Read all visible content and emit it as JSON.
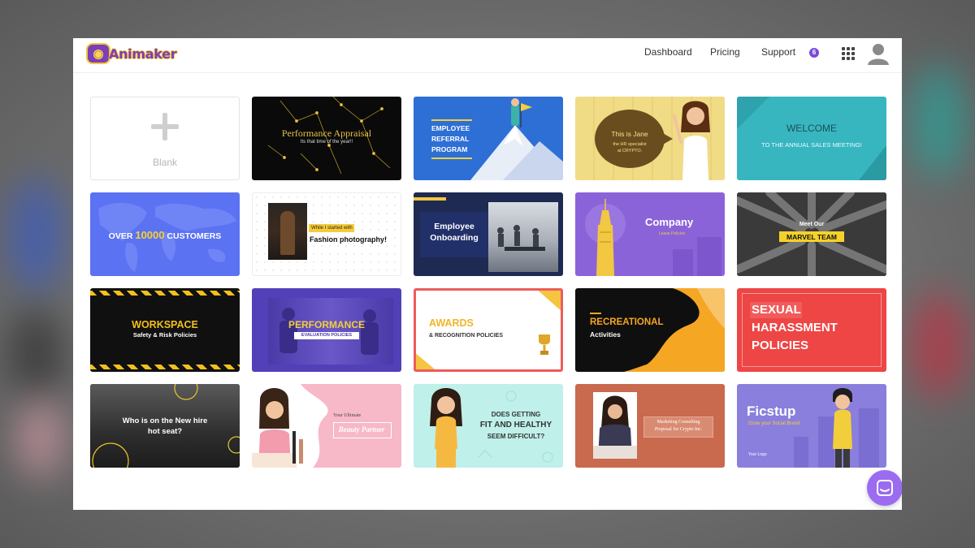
{
  "brand": {
    "name": "Animaker",
    "accent": "#7b3fb8",
    "logo_icon": "animaker-logo-icon"
  },
  "nav": {
    "dashboard": "Dashboard",
    "pricing": "Pricing",
    "support": "Support",
    "notification_count": "6"
  },
  "icons": {
    "apps": "apps-grid-icon",
    "avatar": "user-avatar-icon",
    "chat": "chat-support-icon"
  },
  "blank": {
    "label": "Blank"
  },
  "templates": {
    "performance_appraisal": {
      "title": "Performance Appraisal",
      "subtitle": "Its that time of the year!!"
    },
    "employee_referral": {
      "title_lines": [
        "EMPLOYEE",
        "REFERRAL",
        "PROGRAM"
      ]
    },
    "hr_specialist": {
      "line1": "This is Jane",
      "line2": "the HR specialist",
      "line3": "at CRYPTO."
    },
    "welcome": {
      "title": "WELCOME",
      "subtitle": "TO THE ANNUAL SALES MEETING!"
    },
    "customers": {
      "prefix": "OVER ",
      "number": "10000",
      "suffix": " CUSTOMERS"
    },
    "fashion": {
      "line1": "While I started with",
      "line2": "Fashion photography!"
    },
    "onboarding": {
      "title_lines": [
        "Employee",
        "Onboarding"
      ]
    },
    "company": {
      "title": "Company",
      "subtitle": "Leave Policies"
    },
    "marvel": {
      "line1": "Meet Our",
      "line2": "MARVEL TEAM"
    },
    "workspace": {
      "title": "WORKSPACE",
      "subtitle": "Safety & Risk Policies"
    },
    "performance_eval": {
      "title": "PERFORMANCE",
      "subtitle": "EVALUATION POLICIES"
    },
    "awards": {
      "title": "AWARDS",
      "subtitle": "& RECOGNITION POLICIES"
    },
    "recreational": {
      "title": "RECREATIONAL",
      "subtitle": "Activities"
    },
    "harassment": {
      "title_lines": [
        "SEXUAL",
        "HARASSMENT",
        "POLICIES"
      ]
    },
    "new_hire": {
      "title_lines": [
        "Who is on the New hire",
        "hot seat?"
      ]
    },
    "beauty": {
      "line1": "Your Ultimate",
      "line2": "Beauty Partner"
    },
    "fit": {
      "title_lines": [
        "DOES GETTING",
        "FIT AND HEALTHY",
        "SEEM DIFFICULT?"
      ]
    },
    "marketing": {
      "title_lines": [
        "Marketing Consulting",
        "Proposal for Crypto Inc."
      ]
    },
    "ficstup": {
      "title": "Ficstup",
      "subtitle": "Grow your Social Brand",
      "footer": "Your Logo"
    }
  }
}
